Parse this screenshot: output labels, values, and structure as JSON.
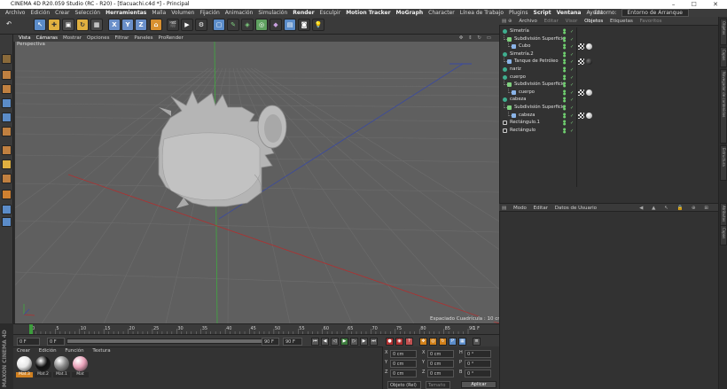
{
  "window": {
    "title": "CINEMA 4D R20.059 Studio (RC - R20) - [tlacuachi.c4d *] - Principal",
    "controls": "–  ☐  ✕"
  },
  "menubar": {
    "items": [
      "Archivo",
      "Edición",
      "Crear",
      "Selección",
      "Herramientas",
      "Malla",
      "Volumen",
      "Fijación",
      "Animación",
      "Simulación",
      "Render",
      "Esculpir",
      "Motion Tracker",
      "MoGraph",
      "Character",
      "Línea de Trabajo",
      "Plugins",
      "Script",
      "Ventana",
      "Ayuda"
    ],
    "environment_label": "Entorno:",
    "environment_value": "Entorno de Arranque"
  },
  "toolbar": {
    "axis_buttons": [
      "X",
      "Y",
      "Z"
    ]
  },
  "viewport": {
    "menu": [
      "Vista",
      "Cámaras",
      "Mostrar",
      "Opciones",
      "Filtrar",
      "Paneles",
      "ProRender"
    ],
    "camera_label": "Perspectiva",
    "grid_spacing": "Espaciado Cuadrícula : 10 cm",
    "background_color": "#5f5f5f"
  },
  "timeline": {
    "ticks": [
      "0",
      "5",
      "10",
      "15",
      "20",
      "25",
      "30",
      "35",
      "40",
      "45",
      "50",
      "55",
      "60",
      "65",
      "70",
      "75",
      "80",
      "85",
      "90"
    ],
    "frame_end_label": "1 F"
  },
  "transport": {
    "current_frame": "0 F",
    "start_frame": "0 F",
    "end_frame": "90 F",
    "preview_end": "90 F"
  },
  "materials": {
    "menu": [
      "Crear",
      "Edición",
      "Función",
      "Textura"
    ],
    "items": [
      {
        "name": "Mat.3",
        "color": "#e8e8e8",
        "selected": true
      },
      {
        "name": "Mat.2",
        "color": "#111111",
        "selected": false
      },
      {
        "name": "Mat.1",
        "color": "#8a8a8a",
        "selected": false
      },
      {
        "name": "Mat",
        "color": "#e8a0b8",
        "selected": false
      }
    ],
    "brand": "MAXON CINEMA 4D"
  },
  "coordinates": {
    "rows": [
      {
        "a": "X",
        "av": "0 cm",
        "b": "X",
        "bv": "0 cm",
        "c": "H",
        "cv": "0 °"
      },
      {
        "a": "Y",
        "av": "0 cm",
        "b": "Y",
        "bv": "0 cm",
        "c": "P",
        "cv": "0 °"
      },
      {
        "a": "Z",
        "av": "0 cm",
        "b": "Z",
        "bv": "0 cm",
        "c": "B",
        "cv": "0 °"
      }
    ],
    "mode": "Objeto (Rel)",
    "size_mode": "Tamaño",
    "apply": "Aplicar"
  },
  "object_manager": {
    "menu": [
      "Archivo",
      "Editar",
      "Visor",
      "Objetos",
      "Etiquetas",
      "Favoritos"
    ],
    "objects": [
      {
        "label": "Simetría",
        "indent": 0,
        "icon": "symmetry"
      },
      {
        "label": "Subdivisión Superficie",
        "indent": 1,
        "icon": "subdiv"
      },
      {
        "label": "Cubo",
        "indent": 2,
        "icon": "polygon",
        "tags": [
          "checker",
          "material-white"
        ]
      },
      {
        "label": "Simetría.2",
        "indent": 0,
        "icon": "symmetry"
      },
      {
        "label": "Tanque de Petróleo",
        "indent": 1,
        "icon": "polygon",
        "tags": [
          "checker",
          "material-black"
        ]
      },
      {
        "label": "nariz",
        "indent": 0,
        "icon": "symmetry"
      },
      {
        "label": "cuerpo",
        "indent": 0,
        "icon": "symmetry"
      },
      {
        "label": "Subdivisión Superficie",
        "indent": 1,
        "icon": "subdiv"
      },
      {
        "label": "cuerpo",
        "indent": 2,
        "icon": "polygon",
        "tags": [
          "checker",
          "material-white"
        ]
      },
      {
        "label": "cabeza",
        "indent": 0,
        "icon": "symmetry"
      },
      {
        "label": "Subdivisión Superficie",
        "indent": 1,
        "icon": "subdiv"
      },
      {
        "label": "cabeza",
        "indent": 2,
        "icon": "polygon",
        "tags": [
          "checker",
          "material-white"
        ]
      },
      {
        "label": "Rectángulo.1",
        "indent": 0,
        "icon": "spline"
      },
      {
        "label": "Rectángulo",
        "indent": 0,
        "icon": "spline"
      }
    ]
  },
  "attribute_manager": {
    "menu": [
      "Modo",
      "Editar",
      "Datos de Usuario"
    ],
    "icons": "◀ ▲ ↖ 🔒 ⊕ ⊞"
  },
  "right_tabs": [
    "Objetos",
    "Capas",
    "Navegador de contenidos",
    "Estructura",
    "Atributos",
    "Capas"
  ]
}
